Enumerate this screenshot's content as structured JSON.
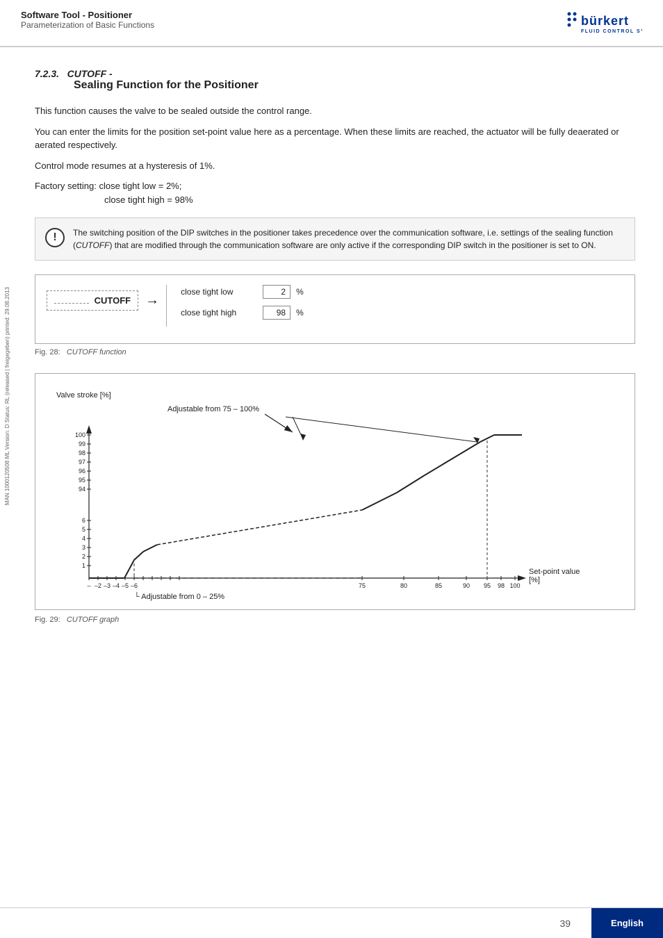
{
  "header": {
    "title": "Software Tool - Positioner",
    "subtitle": "Parameterization of Basic Functions"
  },
  "logo": {
    "name": "bürkert",
    "tagline": "FLUID CONTROL SYSTEMS"
  },
  "sidebar": {
    "text": "MAN  1000120508  ML  Version: D  Status: RL (released | freigegeben)  printed: 29.08.2013"
  },
  "section": {
    "number": "7.2.3.",
    "title_italic": "CUTOFF -",
    "title_bold": "Sealing Function for the Positioner"
  },
  "body_paragraphs": [
    "This function causes the valve to be sealed outside the control range.",
    "You can enter the limits for the position set-point value here as a percentage. When these limits are reached, the actuator will be fully deaerated or aerated respectively.",
    "Control mode resumes at a hysteresis of 1%.",
    "Factory setting: close tight low = 2%;\n           close tight high = 98%"
  ],
  "warning": {
    "text": "The switching position of the DIP switches in the positioner takes precedence over the communication software, i.e. settings of the sealing function (CUTOFF) that are modified through the communication software are only active if the corresponding DIP switch in the positioner is set to ON."
  },
  "diagram": {
    "cutoff_label": "CUTOFF",
    "params": [
      {
        "label": "close tight low",
        "value": "2",
        "unit": "%"
      },
      {
        "label": "close tight high",
        "value": "98",
        "unit": "%"
      }
    ]
  },
  "fig28_caption": "Fig. 28:",
  "fig28_label": "CUTOFF function",
  "graph": {
    "y_axis_label": "Valve stroke [%]",
    "x_axis_label": "Set-point value\n[%]",
    "adjustable_high_label": "Adjustable from 75 – 100%",
    "adjustable_low_label": "Adjustable from 0 – 25%",
    "y_ticks": [
      "100",
      "99",
      "98",
      "97",
      "96",
      "95",
      "94",
      "6",
      "5",
      "4",
      "3",
      "2",
      "1"
    ],
    "x_ticks_low": [
      "–",
      "–2",
      "–3",
      "–4",
      "–5",
      "–6"
    ],
    "x_ticks_high": [
      "75",
      "80",
      "85",
      "90",
      "95",
      "98",
      "100"
    ]
  },
  "fig29_caption": "Fig. 29:",
  "fig29_label": "CUTOFF graph",
  "footer": {
    "page_number": "39",
    "language": "English"
  }
}
